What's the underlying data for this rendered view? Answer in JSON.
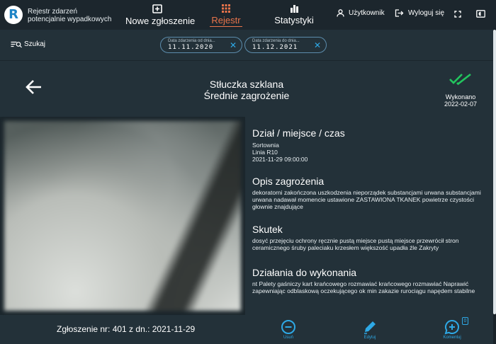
{
  "header": {
    "app_title_line1": "Rejestr zdarzeń",
    "app_title_line2": "potencjalnie wypadkowych",
    "logo_letter": "R",
    "nav": [
      {
        "label": "Nowe zgłoszenie",
        "icon": "plus-square-icon",
        "active": false
      },
      {
        "label": "Rejestr",
        "icon": "grid-icon",
        "active": true
      },
      {
        "label": "Statystyki",
        "icon": "bar-chart-icon",
        "active": false
      }
    ],
    "user_label": "Użytkownik",
    "logout_label": "Wyloguj się",
    "colors": {
      "accent": "#e9744b",
      "link": "#2ea9e6",
      "ok": "#22c55e"
    }
  },
  "filters": {
    "search_label": "Szukaj",
    "date_from": {
      "label": "Data zdarzenia od dnia...",
      "value": "11.11.2020"
    },
    "date_to": {
      "label": "Data zdarzenia do dnia...",
      "value": "11.12.2021"
    }
  },
  "incident": {
    "title": "Stłuczka szklana",
    "threat_level": "Średnie zagrożenie",
    "status": "Wykonano",
    "status_date": "2022-02-07",
    "sections": {
      "place_title": "Dział / miejsce / czas",
      "department": "Sortownia",
      "line": "Linia R10",
      "datetime": "2021-11-29 09:00:00",
      "threat_title": "Opis zagrożenia",
      "threat_text": "dekoratorni zakończona uszkodzenia nieporządek substancjami urwana substancjami urwana nadawał momencie ustawione ZASTAWIONA TKANEK powietrze czystości głownie znajdujące",
      "effect_title": "Skutek",
      "effect_text": "dosyć przejęciu ochrony ręcznie pustą miejsce pustą miejsce przewrócił stron ceramicznego śruby paleciaku krzesłem większość upadła źle Zakryty",
      "actions_title": "Działania do wykonania",
      "actions_text": "nt Palety gaśniczy kart krańcowego rozmawiać krańcowego rozmawiać Naprawić zapewniając odblaskową oczekującego ok min zakazie rurociągu napędem stabilne"
    }
  },
  "footer": {
    "report_id": "Zgłoszenie nr: 401 z dn.: 2021-11-29",
    "delete_label": "Usuń",
    "edit_label": "Edytuj",
    "comments_label": "Komentuj",
    "comments_count": "0"
  }
}
